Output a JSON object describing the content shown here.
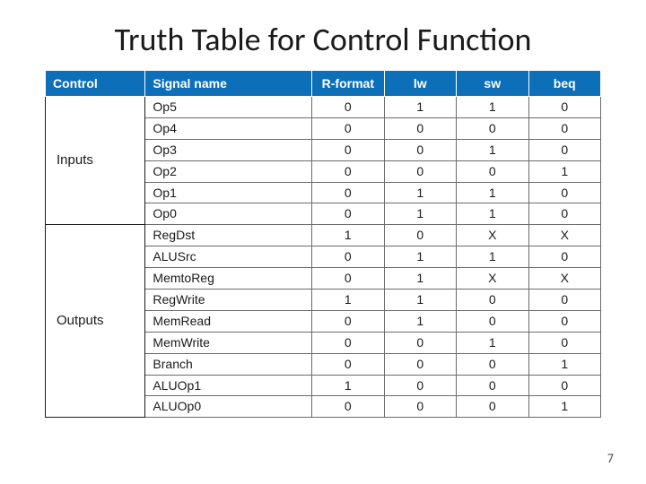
{
  "title": "Truth Table for Control Function",
  "page_number": "7",
  "chart_data": {
    "type": "table",
    "title": "Truth Table for Control Function",
    "headers": {
      "control": "Control",
      "signal": "Signal name",
      "cols": [
        "R-format",
        "lw",
        "sw",
        "beq"
      ]
    },
    "groups": [
      {
        "name": "Inputs",
        "rows": [
          {
            "signal": "Op5",
            "values": [
              "0",
              "1",
              "1",
              "0"
            ]
          },
          {
            "signal": "Op4",
            "values": [
              "0",
              "0",
              "0",
              "0"
            ]
          },
          {
            "signal": "Op3",
            "values": [
              "0",
              "0",
              "1",
              "0"
            ]
          },
          {
            "signal": "Op2",
            "values": [
              "0",
              "0",
              "0",
              "1"
            ]
          },
          {
            "signal": "Op1",
            "values": [
              "0",
              "1",
              "1",
              "0"
            ]
          },
          {
            "signal": "Op0",
            "values": [
              "0",
              "1",
              "1",
              "0"
            ]
          }
        ]
      },
      {
        "name": "Outputs",
        "rows": [
          {
            "signal": "RegDst",
            "values": [
              "1",
              "0",
              "X",
              "X"
            ]
          },
          {
            "signal": "ALUSrc",
            "values": [
              "0",
              "1",
              "1",
              "0"
            ]
          },
          {
            "signal": "MemtoReg",
            "values": [
              "0",
              "1",
              "X",
              "X"
            ]
          },
          {
            "signal": "RegWrite",
            "values": [
              "1",
              "1",
              "0",
              "0"
            ]
          },
          {
            "signal": "MemRead",
            "values": [
              "0",
              "1",
              "0",
              "0"
            ]
          },
          {
            "signal": "MemWrite",
            "values": [
              "0",
              "0",
              "1",
              "0"
            ]
          },
          {
            "signal": "Branch",
            "values": [
              "0",
              "0",
              "0",
              "1"
            ]
          },
          {
            "signal": "ALUOp1",
            "values": [
              "1",
              "0",
              "0",
              "0"
            ]
          },
          {
            "signal": "ALUOp0",
            "values": [
              "0",
              "0",
              "0",
              "1"
            ]
          }
        ]
      }
    ]
  }
}
